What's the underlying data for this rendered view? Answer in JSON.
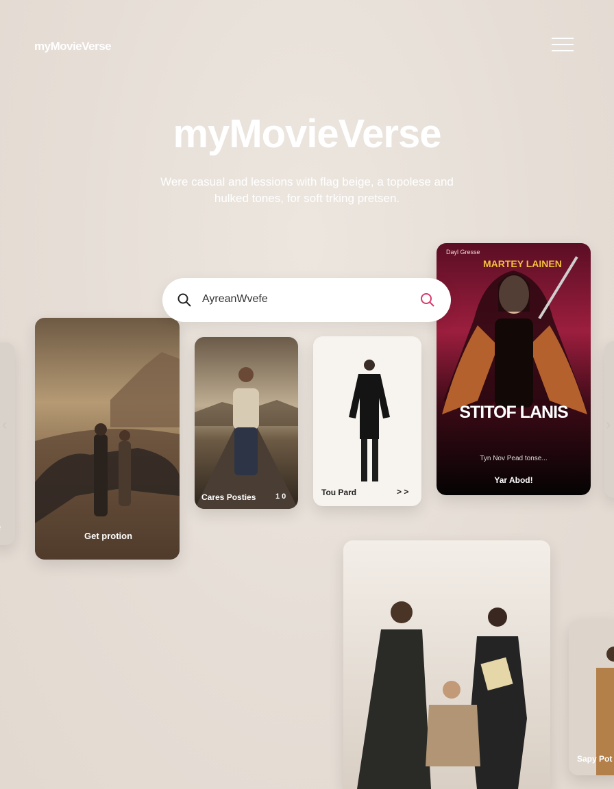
{
  "header": {
    "brand": "myMovieVerse",
    "menu_icon": "hamburger-icon"
  },
  "hero": {
    "title": "myMovieVerse",
    "subtitle_line1": "Were casual and lessions with flag beige, a topolese and",
    "subtitle_line2": "hulked tones, for soft trking pretsen."
  },
  "search": {
    "value": "AyreanWvefe",
    "icon": "search-icon",
    "submit_icon": "search-icon"
  },
  "cards": {
    "left_edge_label": "e",
    "desert": {
      "label": "Get protion"
    },
    "road": {
      "label": "Cares Posties",
      "badge": "1 0"
    },
    "white": {
      "label": "Tou Pard",
      "arrow": "> >"
    },
    "poster": {
      "top_left": "Dayl Gresse",
      "top_title": "MARTEY LAINEN",
      "main_title": "STITOF LANIS",
      "tagline": "Tyn Nov Pead tonse...",
      "cta": "Yar Abod!"
    },
    "right_edge_label": "Sapy Pot"
  },
  "colors": {
    "accent": "#d63a6a",
    "background": "#e8e1da",
    "poster_bg": "#7a1630"
  }
}
